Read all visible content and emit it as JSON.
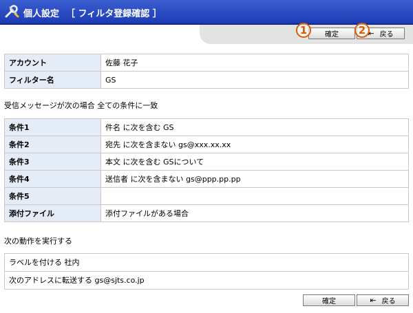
{
  "header": {
    "title": "個人設定",
    "subtitle": "［ フィルタ登録確認 ］",
    "icon": "tools-icon"
  },
  "toolbar": {
    "confirm_label": "確定",
    "back_label": "戻る",
    "marker_1": "1",
    "marker_2": "2"
  },
  "account_table": [
    {
      "label": "アカウント",
      "value": "佐藤 花子"
    },
    {
      "label": "フィルター名",
      "value": "GS"
    }
  ],
  "condition_intro": "受信メッセージが次の場合 全ての条件に一致",
  "conditions": [
    {
      "label": "条件1",
      "value": "件名 に次を含む GS"
    },
    {
      "label": "条件2",
      "value": "宛先 に次を含まない gs@xxx.xx.xx"
    },
    {
      "label": "条件3",
      "value": "本文 に次を含む GSについて"
    },
    {
      "label": "条件4",
      "value": "送信者 に次を含まない gs@ppp.pp.pp"
    },
    {
      "label": "条件5",
      "value": ""
    },
    {
      "label": "添付ファイル",
      "value": "添付ファイルがある場合"
    }
  ],
  "action_intro": "次の動作を実行する",
  "actions": [
    "ラベルを付ける 社内",
    "次のアドレスに転送する gs@sjts.co.jp"
  ],
  "footer": {
    "confirm_label": "確定",
    "back_label": "戻る"
  },
  "colors": {
    "header_bg": "#2a4cc4",
    "label_bg": "#e4ecf8",
    "marker": "#e05a00"
  }
}
